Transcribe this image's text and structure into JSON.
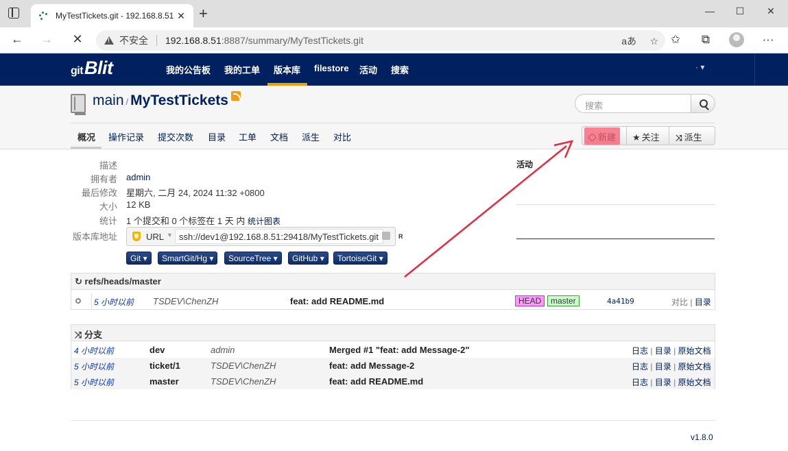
{
  "browser": {
    "tab_title": "MyTestTickets.git - 192.168.8.51",
    "insecure_label": "不安全",
    "url_host": "192.168.8.51",
    "url_path": ":8887/summary/MyTestTickets.git",
    "read_aloud": "aあ"
  },
  "nav": {
    "brand": "Blit",
    "brand_prefix": "git",
    "items": [
      "我的公告板",
      "我的工单",
      "版本库",
      "filestore",
      "活动",
      "搜索"
    ],
    "active": "版本库",
    "user_menu": "·"
  },
  "repo": {
    "project": "main",
    "separator": "/",
    "name": "MyTestTickets",
    "search_placeholder": "搜索",
    "tabs": [
      "概况",
      "操作记录",
      "提交次数",
      "目录",
      "工单",
      "文档",
      "派生",
      "对比"
    ],
    "active_tab": "概况",
    "buttons": {
      "new": "新建",
      "watch": "关注",
      "fork": "派生"
    }
  },
  "summary": {
    "labels": {
      "description": "描述",
      "owner": "拥有者",
      "last_change": "最后修改",
      "size": "大小",
      "stats": "统计",
      "repo_url": "版本库地址"
    },
    "owner": "admin",
    "last_change": "星期六, 二月 24, 2024 11:32 +0800",
    "size": "12 KB",
    "stats": "1 个提交和 0 个标签在 1 天 内",
    "stats_link": "统计图表",
    "url_label": "URL",
    "url": "ssh://dev1@192.168.8.51:29418/MyTestTickets.git",
    "access_mark": "R",
    "clients": [
      "Git",
      "SmartGit/Hg",
      "SourceTree",
      "GitHub",
      "TortoiseGit"
    ],
    "activity_title": "活动"
  },
  "log": {
    "header": "refs/heads/master",
    "rows": [
      {
        "time": "5 小时以前",
        "author": "TSDEV\\ChenZH",
        "message": "feat: add README.md",
        "tags": [
          "HEAD",
          "master"
        ],
        "sha": "4a41b9",
        "links": [
          "对比",
          "目录"
        ]
      }
    ]
  },
  "branches": {
    "header": "分支",
    "rows": [
      {
        "time": "4 小时以前",
        "name": "dev",
        "author": "admin",
        "message": "Merged #1 \"feat: add Message-2\"",
        "links": [
          "日志",
          "目录",
          "原始文档"
        ]
      },
      {
        "time": "5 小时以前",
        "name": "ticket/1",
        "author": "TSDEV\\ChenZH",
        "message": "feat: add Message-2",
        "links": [
          "日志",
          "目录",
          "原始文档"
        ]
      },
      {
        "time": "5 小时以前",
        "name": "master",
        "author": "TSDEV\\ChenZH",
        "message": "feat: add README.md",
        "links": [
          "日志",
          "目录",
          "原始文档"
        ]
      }
    ]
  },
  "footer": {
    "version": "v1.8.0"
  },
  "colors": {
    "navbar": "#002060",
    "active_nav": "#f0a000",
    "annotation_arrow": "#e8283c",
    "highlight": "#f55a6e"
  }
}
